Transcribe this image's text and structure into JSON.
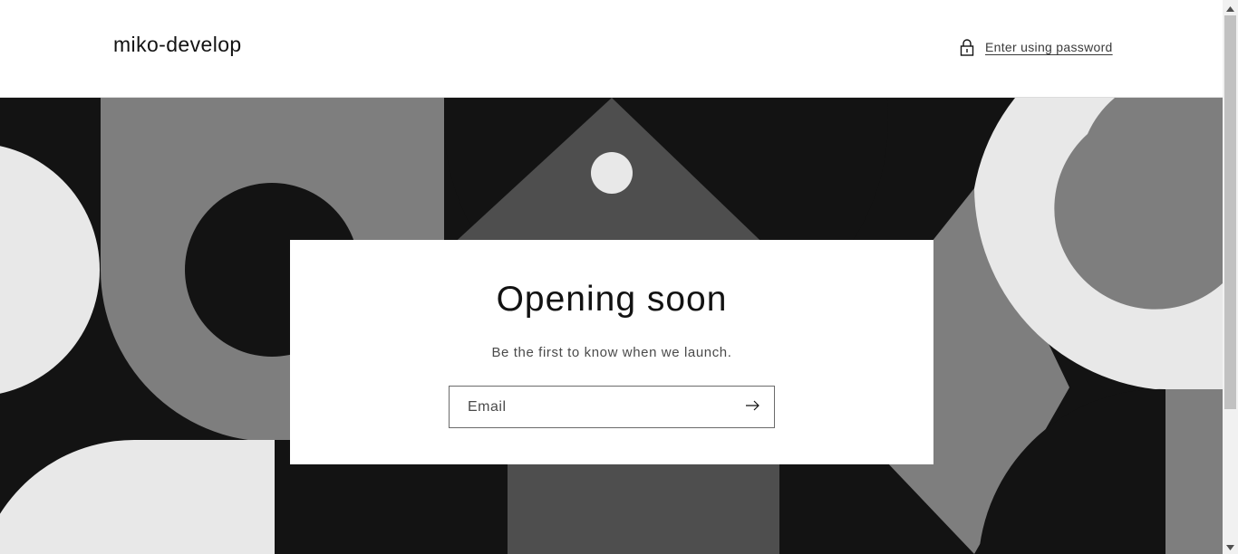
{
  "header": {
    "store_name": "miko-develop",
    "password_link_label": "Enter using password"
  },
  "card": {
    "title": "Opening soon",
    "subtitle": "Be the first to know when we launch.",
    "email_placeholder": "Email",
    "email_value": ""
  },
  "icons": {
    "lock": "lock-icon",
    "submit": "arrow-right-icon",
    "scroll_up": "triangle-up-icon",
    "scroll_down": "triangle-down-icon"
  },
  "colors": {
    "banner_black": "#131313",
    "banner_dark_gray": "#4e4e4e",
    "banner_mid_gray": "#7e7e7e",
    "banner_light_gray": "#e8e8e8",
    "text": "#121212"
  }
}
